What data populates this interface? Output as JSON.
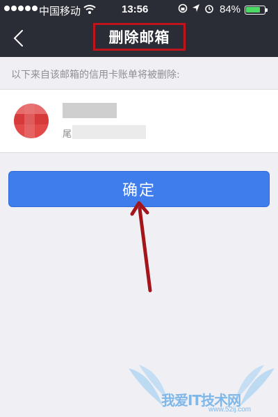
{
  "status_bar": {
    "carrier": "中国移动",
    "time": "13:56",
    "battery_percent": "84%",
    "battery_level": 0.84,
    "icons": [
      "signal-dots-icon",
      "wifi-icon",
      "rotation-lock-icon",
      "location-icon",
      "alarm-icon",
      "battery-icon"
    ]
  },
  "nav": {
    "back_icon": "chevron-left-icon",
    "title": "删除邮箱",
    "title_highlight_color": "#c0141c"
  },
  "info_text": "以下来自该邮箱的信用卡账单将被删除:",
  "account": {
    "tail_char": "尾"
  },
  "confirm_button": {
    "label": "确定",
    "color": "#3f7ded"
  },
  "watermark": {
    "text": "我爱IT技术网",
    "url": "www.52ij.com"
  },
  "colors": {
    "nav_background": "#2a2d36",
    "page_background": "#efeff4",
    "annotation_arrow": "#a3151a"
  }
}
